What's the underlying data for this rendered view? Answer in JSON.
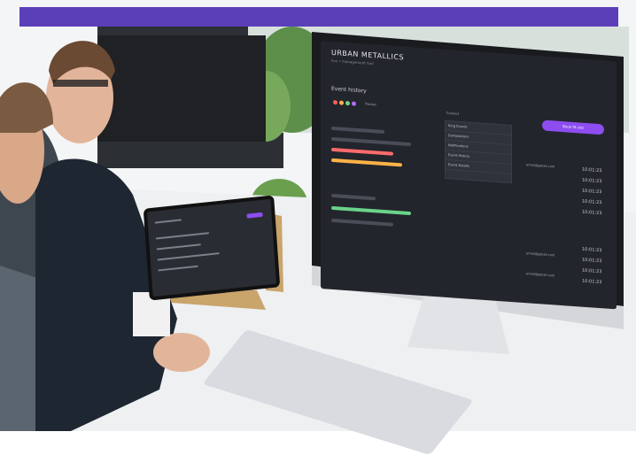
{
  "screen": {
    "title": "URBAN METALLICS",
    "subtitle": "live • management tool",
    "heading": "Event history",
    "button": "Book fit slot",
    "filter_left": "Tracker",
    "filter_right": "Contact",
    "dropdown_items": [
      "Ring Events",
      "Dumptations",
      "Notifications",
      "Event History",
      "Event Details"
    ],
    "times": [
      "10:01:23",
      "10:01:23",
      "10:01:23",
      "10:01:23",
      "10:01:23",
      "10:01:23",
      "10:01:23",
      "10:01:23",
      "10:01:23"
    ],
    "emails": [
      "email@gmail.com",
      "email@gmail.com",
      "email@gmail.com"
    ]
  },
  "colors": {
    "banner": "#5b3fb8",
    "accent": "#8d4df0",
    "screen_bg": "#23252c"
  }
}
